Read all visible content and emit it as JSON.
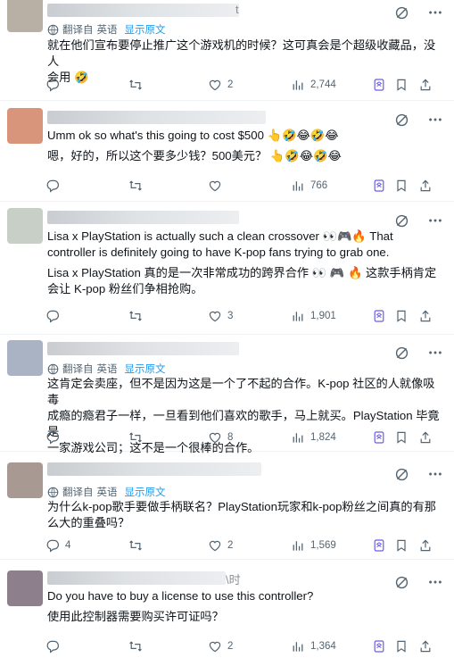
{
  "tweets": [
    {
      "avatar_color": "#b9b0a5",
      "header_fragment": "t",
      "translate": {
        "prefix": "翻译自",
        "lang": "英语",
        "link": "显示原文"
      },
      "lines": [
        "就在他们宣布要停止推广这个游戏机的时候？这可真会是个超级收藏品，没人",
        "会用 🤣"
      ],
      "likes": "2",
      "views": "2,744"
    },
    {
      "avatar_color": "#d9957c",
      "header_fragment": "",
      "lines": [
        "Umm ok so what's this going to cost $500 👆🤣😂🤣😂",
        "嗯，好的，所以这个要多少钱？500美元？ 👆🤣😂🤣😂"
      ],
      "likes": "",
      "views": "766"
    },
    {
      "avatar_color": "#c7cfc6",
      "header_fragment": "",
      "lines": [
        "Lisa x PlayStation is actually such a clean crossover 👀🎮🔥 That",
        "controller is definitely going to have K-pop fans trying to grab one.",
        "Lisa x PlayStation 真的是一次非常成功的跨界合作 👀 🎮 🔥 这款手柄肯定",
        "会让 K-pop 粉丝们争相抢购。"
      ],
      "likes": "3",
      "views": "1,901"
    },
    {
      "avatar_color": "#a9b3c3",
      "header_fragment": "",
      "translate": {
        "prefix": "翻译自",
        "lang": "英语",
        "link": "显示原文"
      },
      "lines": [
        "这肯定会卖座，但不是因为这是一个了不起的合作。K-pop 社区的人就像吸毒",
        "成瘾的瘾君子一样，一旦看到他们喜欢的歌手，马上就买。PlayStation 毕竟是",
        "一家游戏公司；这不是一个很棒的合作。"
      ],
      "likes": "8",
      "views": "1,824"
    },
    {
      "avatar_color": "#a89a93",
      "header_fragment": "",
      "translate": {
        "prefix": "翻译自",
        "lang": "英语",
        "link": "显示原文"
      },
      "lines": [
        "为什么k-pop歌手要做手柄联名？PlayStation玩家和k-pop粉丝之间真的有那",
        "么大的重叠吗？"
      ],
      "replies": "4",
      "likes": "2",
      "views": "1,569"
    },
    {
      "avatar_color": "#8d7f8c",
      "header_fragment": "\\时",
      "lines": [
        "Do you have to buy a license to use this controller?",
        "使用此控制器需要购买许可证吗？"
      ],
      "likes": "2",
      "views": "1,364"
    }
  ],
  "icons": [
    "reply-icon",
    "retweet-icon",
    "like-icon",
    "views-icon",
    "bookmark-grok-icon",
    "bookmark-icon",
    "share-icon",
    "grok-icon",
    "more-icon",
    "translate-icon"
  ]
}
